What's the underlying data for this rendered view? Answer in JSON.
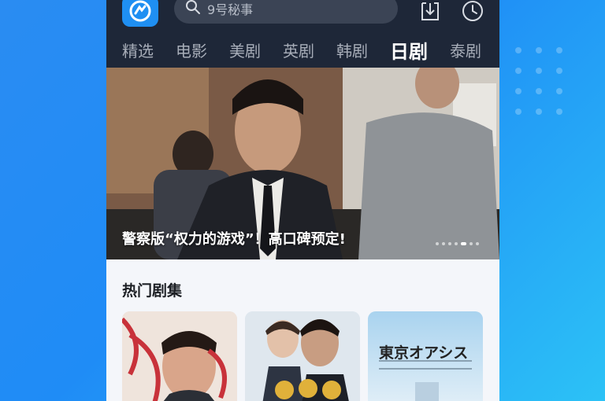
{
  "search": {
    "placeholder": "9号秘事"
  },
  "tabs": [
    {
      "label": "精选"
    },
    {
      "label": "电影"
    },
    {
      "label": "美剧"
    },
    {
      "label": "英剧"
    },
    {
      "label": "韩剧"
    },
    {
      "label": "日剧",
      "active": true
    },
    {
      "label": "泰剧"
    }
  ],
  "banner": {
    "caption": "警察版“权力的游戏”！高口碑预定!",
    "slide_count": 7,
    "active_slide": 5
  },
  "section": {
    "title": "热门剧集"
  },
  "posters": [
    {
      "name": "poster-1"
    },
    {
      "name": "poster-2"
    },
    {
      "name": "poster-3",
      "title": "東京オアシス"
    }
  ],
  "colors": {
    "accent": "#27a3f7",
    "topbar": "#1e2738",
    "background": "#2a8cf2"
  },
  "icons": [
    "app-logo-icon",
    "search-icon",
    "download-icon",
    "clock-icon"
  ]
}
